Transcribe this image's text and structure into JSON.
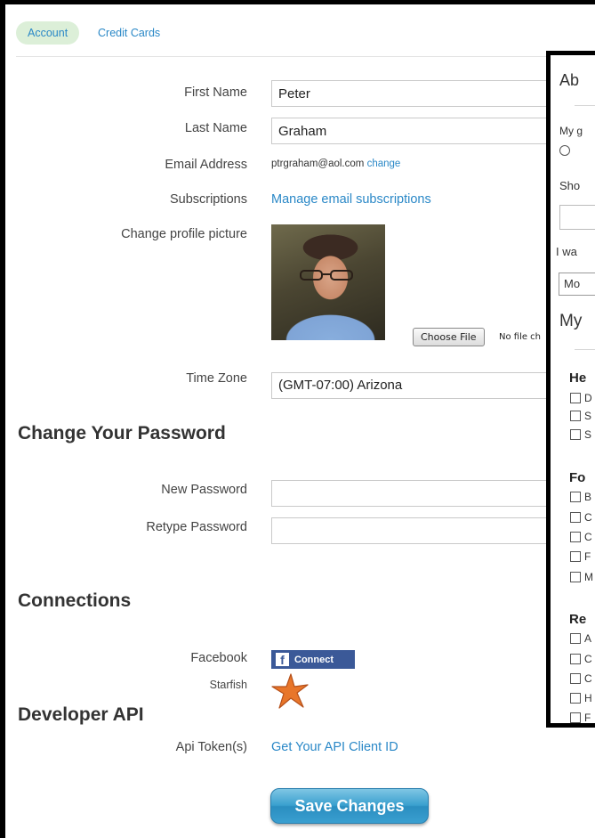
{
  "tabs": [
    {
      "label": "Account"
    },
    {
      "label": "Credit Cards"
    }
  ],
  "form": {
    "first_name": {
      "label": "First Name",
      "value": "Peter"
    },
    "last_name": {
      "label": "Last Name",
      "value": "Graham"
    },
    "email": {
      "label": "Email Address",
      "value": "ptrgraham@aol.com",
      "change_label": "change"
    },
    "subscriptions": {
      "label": "Subscriptions",
      "link": "Manage email subscriptions"
    },
    "profile_picture": {
      "label": "Change profile picture",
      "choose_file": "Choose File",
      "no_file": "No file ch"
    },
    "time_zone": {
      "label": "Time Zone",
      "value": "(GMT-07:00) Arizona"
    }
  },
  "password": {
    "heading": "Change Your Password",
    "new_label": "New Password",
    "retype_label": "Retype Password"
  },
  "connections": {
    "heading": "Connections",
    "facebook_label": "Facebook",
    "facebook_button": "Connect",
    "starfish_label": "Starfish"
  },
  "developer": {
    "heading": "Developer API",
    "token_label": "Api Token(s)",
    "token_link": "Get Your API Client ID"
  },
  "save_button": "Save Changes",
  "panel": {
    "title": "Ab",
    "line1": "My g",
    "line2": "Sho",
    "line3": "I wa",
    "select_value": "Mo",
    "section": "My",
    "groups": [
      {
        "title": "He",
        "items": [
          "D",
          "S",
          "S"
        ]
      },
      {
        "title": "Fo",
        "items": [
          "B",
          "C",
          "C",
          "F",
          "M"
        ]
      },
      {
        "title": "Re",
        "items": [
          "A",
          "C",
          "C",
          "H",
          "F"
        ]
      }
    ]
  },
  "colors": {
    "link": "#2a88c7",
    "tab_active_bg": "#dcefd8",
    "facebook": "#3b5998",
    "save_button": "#3aa0cf"
  },
  "icons": {
    "facebook": "facebook-f-icon",
    "starfish": "starfish-icon"
  }
}
